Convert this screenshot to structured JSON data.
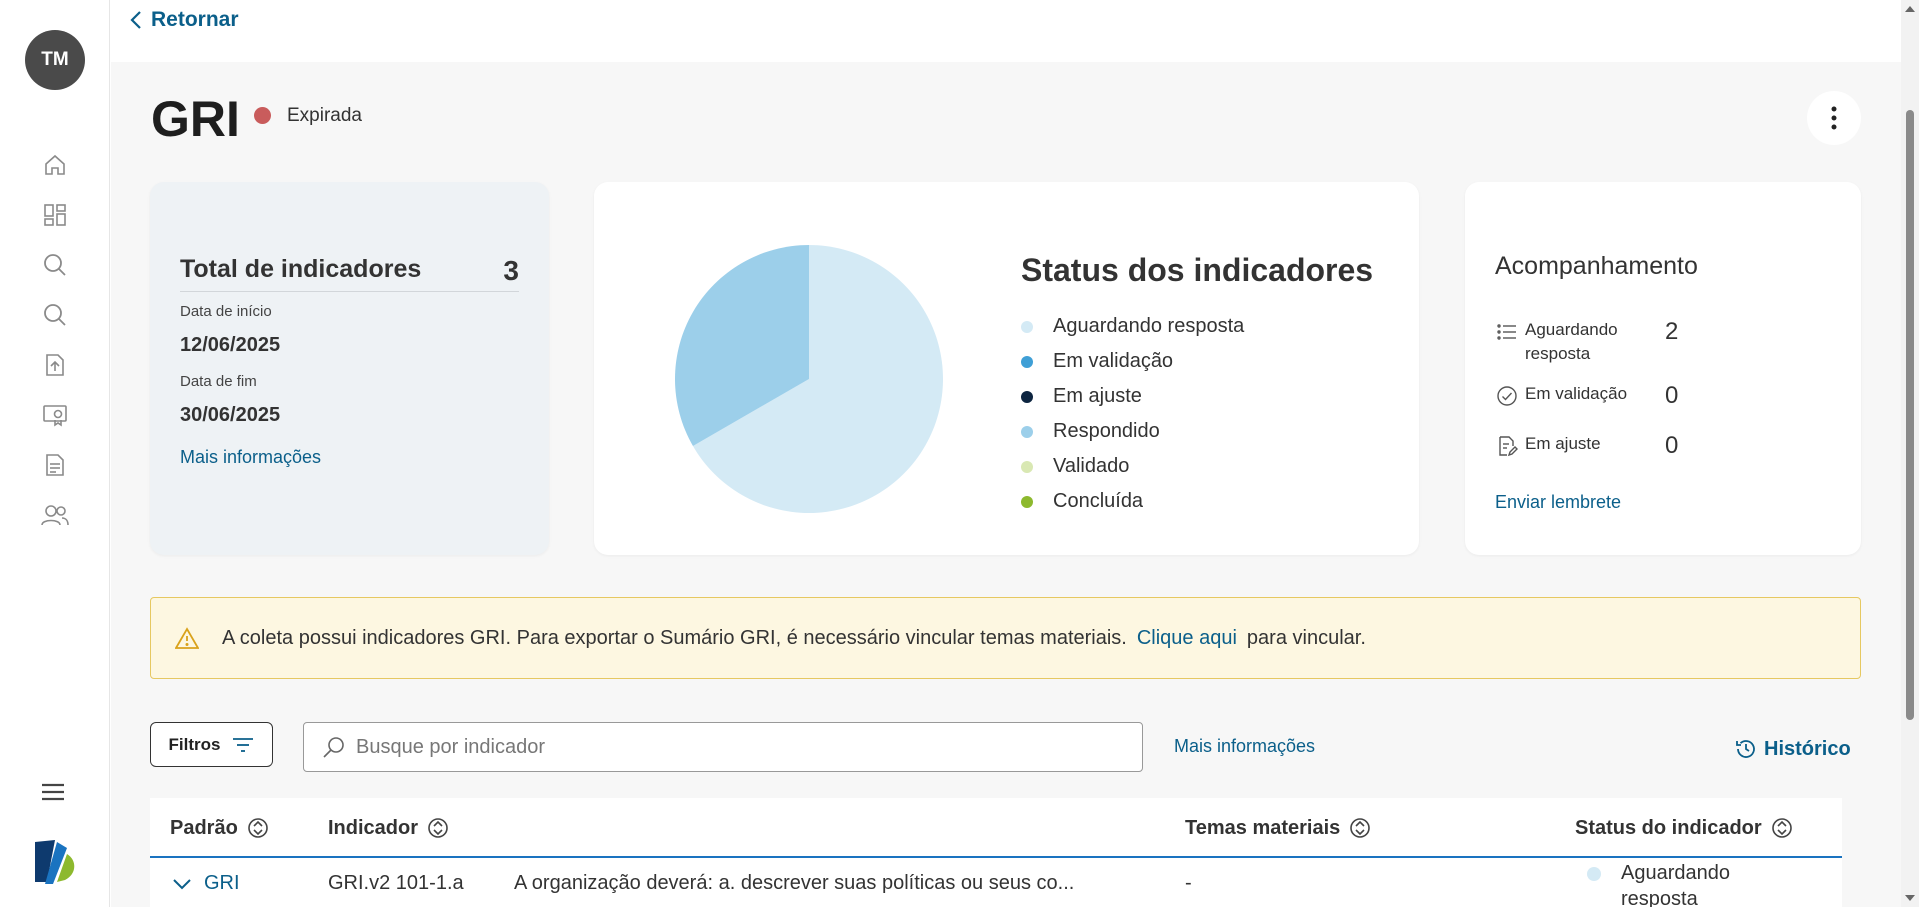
{
  "sidebar": {
    "avatar_initials": "TM",
    "nav_icons": [
      "home-icon",
      "dashboard-icon",
      "search-icon",
      "search-icon",
      "upload-icon",
      "certificate-icon",
      "report-icon",
      "users-icon"
    ],
    "menu_icon": "menu-icon"
  },
  "topbar": {
    "back_label": "Retornar"
  },
  "header": {
    "title": "GRI",
    "status_label": "Expirada",
    "status_color": "#c95c5c"
  },
  "summary": {
    "total_label": "Total de indicadores",
    "total_value": "3",
    "start_label": "Data de início",
    "start_value": "12/06/2025",
    "end_label": "Data de fim",
    "end_value": "30/06/2025",
    "more_info": "Mais informações"
  },
  "status_chart": {
    "title": "Status dos indicadores",
    "legend": [
      {
        "label": "Aguardando resposta",
        "color": "#d4eaf5"
      },
      {
        "label": "Em validação",
        "color": "#3f9fd6"
      },
      {
        "label": "Em ajuste",
        "color": "#0d2540"
      },
      {
        "label": "Respondido",
        "color": "#9ccfea"
      },
      {
        "label": "Validado",
        "color": "#d9e8b3"
      },
      {
        "label": "Concluída",
        "color": "#8db92e"
      }
    ]
  },
  "chart_data": {
    "type": "pie",
    "title": "Status dos indicadores",
    "slices": [
      {
        "label": "Aguardando resposta",
        "value": 2,
        "color": "#d4eaf5"
      },
      {
        "label": "Respondido",
        "value": 1,
        "color": "#9ccfea"
      }
    ]
  },
  "tracking": {
    "title": "Acompanhamento",
    "rows": [
      {
        "label": "Aguardando resposta",
        "value": "2",
        "icon": "list-icon"
      },
      {
        "label": "Em validação",
        "value": "0",
        "icon": "check-circle-icon"
      },
      {
        "label": "Em ajuste",
        "value": "0",
        "icon": "edit-document-icon"
      }
    ],
    "send_reminder": "Enviar lembrete"
  },
  "warning": {
    "text_before": "A coleta possui indicadores GRI. Para exportar o Sumário GRI, é necessário vincular temas materiais.",
    "link": "Clique aqui",
    "text_after": "para vincular."
  },
  "toolbar": {
    "filter_label": "Filtros",
    "search_placeholder": "Busque por indicador",
    "more_info": "Mais informações",
    "history_label": "Histórico"
  },
  "table": {
    "columns": [
      "Padrão",
      "Indicador",
      "Temas materiais",
      "Status do indicador"
    ],
    "rows": [
      {
        "standard": "GRI",
        "code": "GRI.v2 101-1.a",
        "description": "A organização deverá: a. descrever suas políticas ou seus co...",
        "themes": "-",
        "status": "Aguardando resposta",
        "status_color": "#d4eaf5"
      }
    ]
  }
}
